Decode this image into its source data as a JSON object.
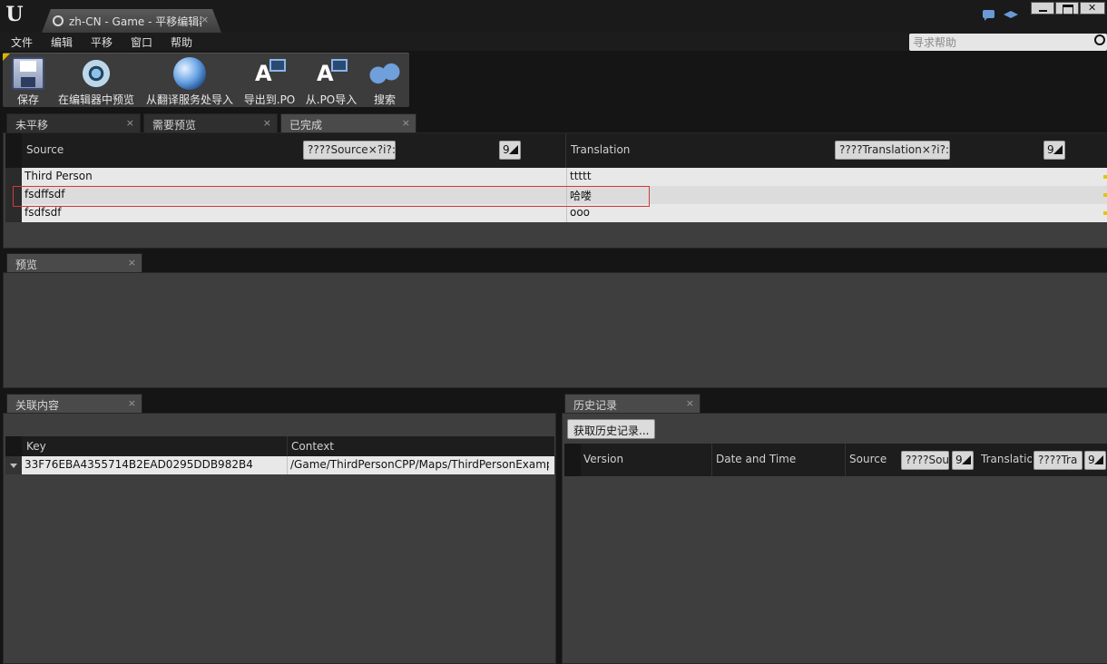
{
  "window": {
    "tab_title": "zh-CN - Game - 平移编辑器",
    "logo": "U"
  },
  "menu": {
    "items": [
      "文件",
      "编辑",
      "平移",
      "窗口",
      "帮助"
    ],
    "help_search_placeholder": "寻求帮助"
  },
  "toolbar": {
    "save": "保存",
    "preview_in_editor": "在编辑器中预览",
    "import_from_service": "从翻译服务处导入",
    "export_po": "导出到.PO",
    "import_po": "从.PO导入",
    "search": "搜索"
  },
  "translation_tabs": [
    {
      "label": "未平移",
      "close": "×"
    },
    {
      "label": "需要预览",
      "close": "×"
    },
    {
      "label": "已完成",
      "close": "×"
    }
  ],
  "translation_table": {
    "source_header": "Source",
    "source_filter": "????Source×?i?:",
    "source_sort": "9",
    "translation_header": "Translation",
    "translation_filter": "????Translation×?i?:",
    "translation_sort": "9",
    "rows": [
      {
        "source": "Third Person",
        "translation": "ttttt"
      },
      {
        "source": "fsdffsdf",
        "translation": "哈喽"
      },
      {
        "source": "fsdfsdf",
        "translation": "ooo"
      }
    ]
  },
  "preview_panel": {
    "tab": "预览",
    "close": "×"
  },
  "context_panel": {
    "tab": "关联内容",
    "close": "×",
    "key_header": "Key",
    "context_header": "Context",
    "rows": [
      {
        "key": "33F76EBA4355714B2EAD0295DDB982B4",
        "context": "/Game/ThirdPersonCPP/Maps/ThirdPersonExampleMap"
      }
    ]
  },
  "history_panel": {
    "tab": "历史记录",
    "close": "×",
    "get_history_button": "获取历史记录...",
    "version_header": "Version",
    "datetime_header": "Date and Time",
    "source_header": "Source",
    "source_filter": "????Sou",
    "source_sort": "9",
    "translation_header": "Translatio",
    "translation_filter": "????Tra",
    "translation_sort": "9"
  }
}
